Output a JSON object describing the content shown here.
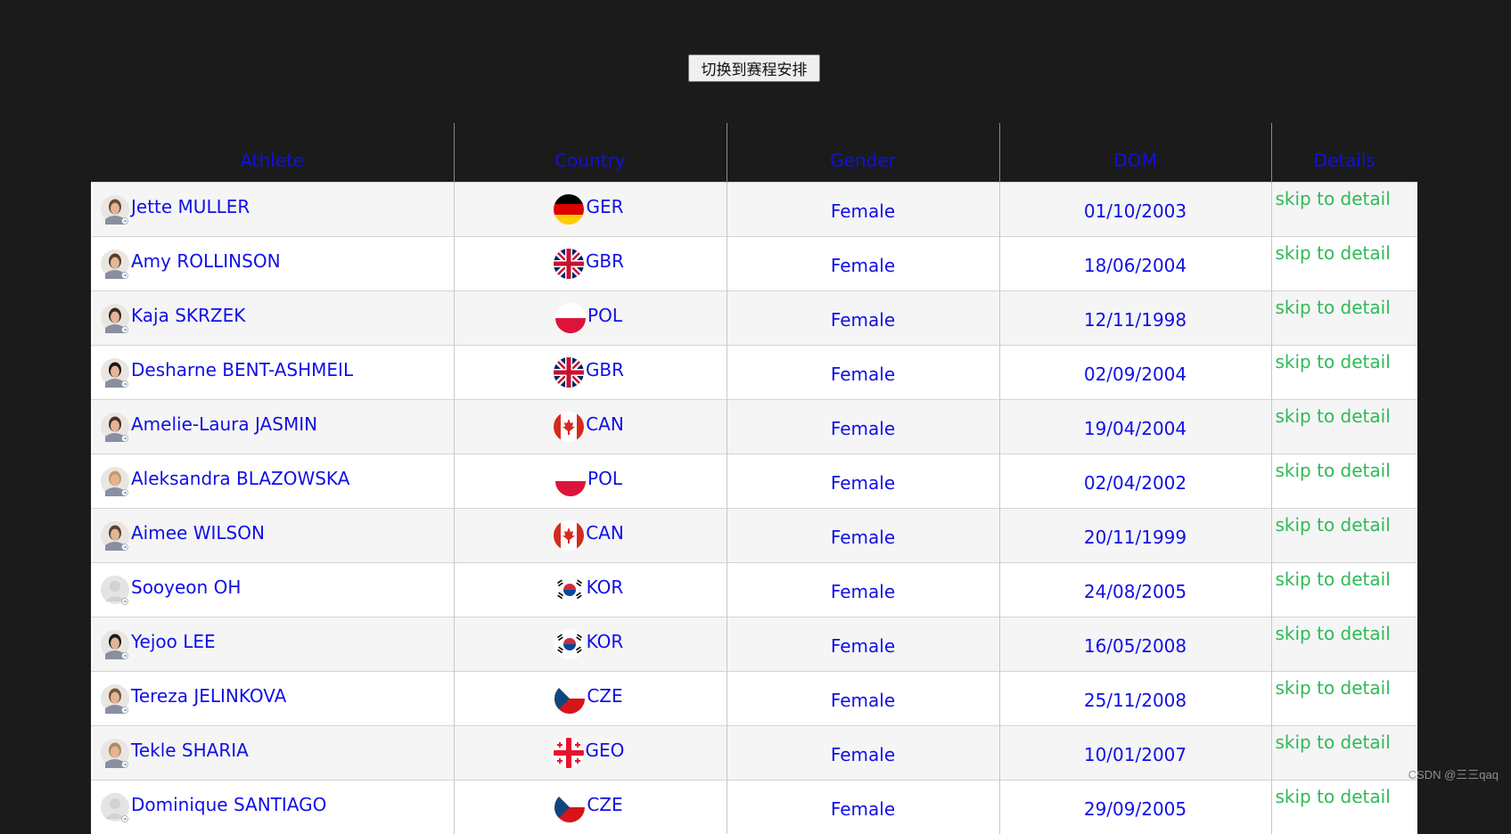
{
  "toolbar": {
    "switch_label": "切换到赛程安排"
  },
  "table": {
    "headers": [
      "Athlete",
      "Country",
      "Gender",
      "DOM",
      "Details"
    ],
    "detail_label": "skip to detail",
    "rows": [
      {
        "name": "Jette MULLER",
        "country": "GER",
        "gender": "Female",
        "dob": "01/10/2003",
        "flag": "germany-flag-icon",
        "avatar": "athlete-photo-icon"
      },
      {
        "name": "Amy ROLLINSON",
        "country": "GBR",
        "gender": "Female",
        "dob": "18/06/2004",
        "flag": "uk-flag-icon",
        "avatar": "athlete-photo-icon"
      },
      {
        "name": "Kaja SKRZEK",
        "country": "POL",
        "gender": "Female",
        "dob": "12/11/1998",
        "flag": "poland-flag-icon",
        "avatar": "athlete-photo-icon"
      },
      {
        "name": "Desharne BENT-ASHMEIL",
        "country": "GBR",
        "gender": "Female",
        "dob": "02/09/2004",
        "flag": "uk-flag-icon",
        "avatar": "athlete-photo-icon"
      },
      {
        "name": "Amelie-Laura JASMIN",
        "country": "CAN",
        "gender": "Female",
        "dob": "19/04/2004",
        "flag": "canada-flag-icon",
        "avatar": "athlete-photo-icon"
      },
      {
        "name": "Aleksandra BLAZOWSKA",
        "country": "POL",
        "gender": "Female",
        "dob": "02/04/2002",
        "flag": "poland-flag-icon",
        "avatar": "athlete-photo-icon"
      },
      {
        "name": "Aimee WILSON",
        "country": "CAN",
        "gender": "Female",
        "dob": "20/11/1999",
        "flag": "canada-flag-icon",
        "avatar": "athlete-photo-icon"
      },
      {
        "name": "Sooyeon OH",
        "country": "KOR",
        "gender": "Female",
        "dob": "24/08/2005",
        "flag": "korea-flag-icon",
        "avatar": "placeholder-avatar-icon"
      },
      {
        "name": "Yejoo LEE",
        "country": "KOR",
        "gender": "Female",
        "dob": "16/05/2008",
        "flag": "korea-flag-icon",
        "avatar": "athlete-photo-icon"
      },
      {
        "name": "Tereza JELINKOVA",
        "country": "CZE",
        "gender": "Female",
        "dob": "25/11/2008",
        "flag": "czech-flag-icon",
        "avatar": "athlete-photo-icon"
      },
      {
        "name": "Tekle SHARIA",
        "country": "GEO",
        "gender": "Female",
        "dob": "10/01/2007",
        "flag": "georgia-flag-icon",
        "avatar": "athlete-photo-icon"
      },
      {
        "name": "Dominique SANTIAGO",
        "country": "CZE",
        "gender": "Female",
        "dob": "29/09/2005",
        "flag": "czech-flag-icon",
        "avatar": "placeholder-avatar-icon"
      }
    ]
  },
  "colors": {
    "background": "#1b1b1b",
    "link_blue": "#1010e6",
    "detail_green": "#2fba55"
  },
  "watermark": "CSDN @三三qaq"
}
